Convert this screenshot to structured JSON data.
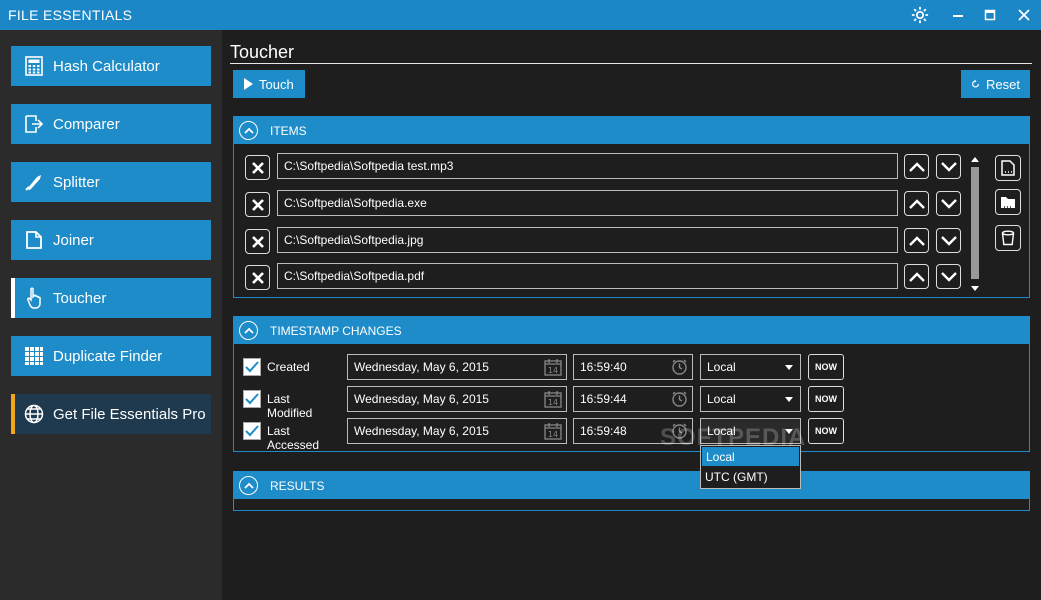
{
  "app": {
    "title": "FILE ESSENTIALS"
  },
  "window_controls": {
    "settings": "gear-icon",
    "minimize": "minimize-icon",
    "maximize": "maximize-icon",
    "close": "close-icon"
  },
  "sidebar": {
    "items": [
      {
        "label": "Hash Calculator",
        "icon": "calculator-icon"
      },
      {
        "label": "Comparer",
        "icon": "compare-icon"
      },
      {
        "label": "Splitter",
        "icon": "knife-icon"
      },
      {
        "label": "Joiner",
        "icon": "document-icon"
      },
      {
        "label": "Touch er",
        "icon": "hand-pointer-icon"
      },
      {
        "label": "Duplicate Finder",
        "icon": "grid-icon"
      },
      {
        "label": "Get File Essentials Pro",
        "icon": "globe-icon"
      }
    ],
    "active_index": 4,
    "active_marker_color": "#ffffff",
    "pro_marker_color": "#f0a818"
  },
  "main": {
    "page_title": "Toucher",
    "touch_label": "Touch",
    "reset_label": "Reset"
  },
  "items_panel": {
    "header": "ITEMS",
    "rows": [
      {
        "path": "C:\\Softpedia\\Softpedia test.mp3"
      },
      {
        "path": "C:\\Softpedia\\Softpedia.exe"
      },
      {
        "path": "C:\\Softpedia\\Softpedia.jpg"
      },
      {
        "path": "C:\\Softpedia\\Softpedia.pdf"
      }
    ]
  },
  "timestamp_panel": {
    "header": "TIMESTAMP CHANGES",
    "rows": [
      {
        "label": "Created",
        "checked": true,
        "date": "Wednesday, May 6, 2015",
        "time": "16:59:40",
        "timezone": "Local",
        "now_label": "NOW"
      },
      {
        "label": "Last Modified",
        "checked": true,
        "date": "Wednesday, May 6, 2015",
        "time": "16:59:44",
        "timezone": "Local",
        "now_label": "NOW"
      },
      {
        "label": "Last Accessed",
        "checked": true,
        "date": "Wednesday, May 6, 2015",
        "time": "16:59:48",
        "timezone": "Local",
        "now_label": "NOW"
      }
    ],
    "calendar_day": "14",
    "timezone_options": [
      "Local",
      "UTC (GMT)"
    ],
    "selected_option_index": 0
  },
  "results_panel": {
    "header": "RESULTS"
  },
  "watermark": "SOFTPEDIA",
  "colors": {
    "accent": "#1e8cc8",
    "titlebar": "#1b87c6",
    "sidebar_bg": "#2b2b2b",
    "main_bg": "#1e1e1e"
  }
}
